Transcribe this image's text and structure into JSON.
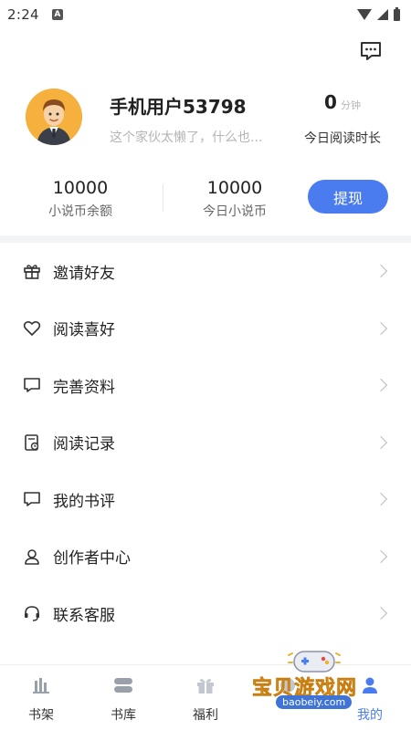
{
  "status_bar": {
    "time": "2:24",
    "notification_letter": "A"
  },
  "profile": {
    "username": "手机用户53798",
    "bio": "这个家伙太懒了，什么也...",
    "read_time_value": "0",
    "read_time_unit": "分钟",
    "read_time_label": "今日阅读时长"
  },
  "coins": {
    "balance_value": "10000",
    "balance_label": "小说币余额",
    "today_value": "10000",
    "today_label": "今日小说币",
    "withdraw_label": "提现"
  },
  "menu": {
    "items": [
      {
        "label": "邀请好友",
        "icon": "gift-icon"
      },
      {
        "label": "阅读喜好",
        "icon": "heart-icon"
      },
      {
        "label": "完善资料",
        "icon": "chat-bubble-icon"
      },
      {
        "label": "阅读记录",
        "icon": "history-icon"
      },
      {
        "label": "我的书评",
        "icon": "comment-icon"
      },
      {
        "label": "创作者中心",
        "icon": "user-icon"
      },
      {
        "label": "联系客服",
        "icon": "headset-icon"
      }
    ]
  },
  "bottom_nav": {
    "items": [
      {
        "label": "书架",
        "icon": "bookshelf-icon"
      },
      {
        "label": "书库",
        "icon": "library-icon"
      },
      {
        "label": "福利",
        "icon": "gift-icon"
      },
      {
        "label": "",
        "icon": "discover-icon"
      },
      {
        "label": "我的",
        "icon": "profile-icon"
      }
    ],
    "active_index": 4
  },
  "watermark": {
    "text": "宝贝游戏网",
    "url": "baobeiy.com"
  },
  "colors": {
    "accent": "#4a7cf0",
    "avatar_bg": "#f5b03e",
    "muted_text": "#b5b5b5"
  }
}
